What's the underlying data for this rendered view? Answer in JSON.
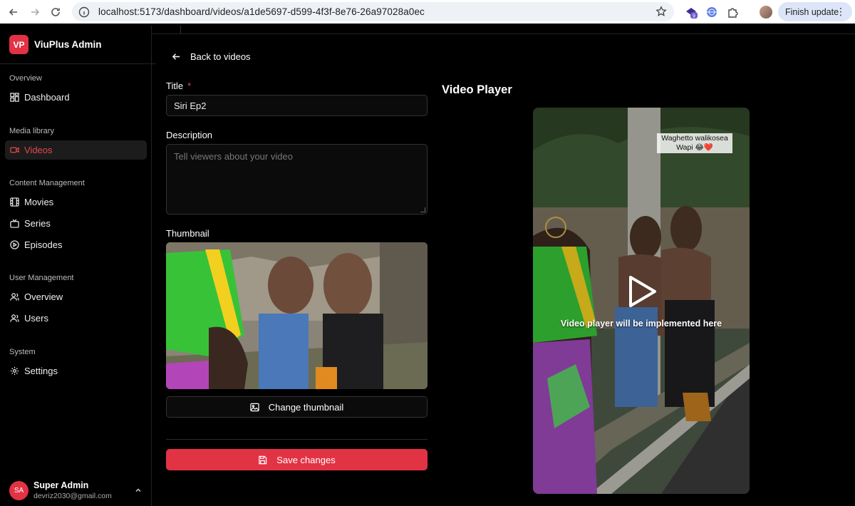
{
  "browser": {
    "url": "localhost:5173/dashboard/videos/a1de5697-d599-4f3f-8e76-26a97028a0ec",
    "extension_badge": "9",
    "finish_update_label": "Finish update"
  },
  "sidebar": {
    "brand": {
      "logo": "VP",
      "name": "ViuPlus Admin"
    },
    "sections": [
      {
        "label": "Overview",
        "items": [
          {
            "label": "Dashboard",
            "icon": "dashboard-icon"
          }
        ]
      },
      {
        "label": "Media library",
        "items": [
          {
            "label": "Videos",
            "icon": "video-icon",
            "active": true
          }
        ]
      },
      {
        "label": "Content Management",
        "items": [
          {
            "label": "Movies",
            "icon": "film-icon"
          },
          {
            "label": "Series",
            "icon": "tv-icon"
          },
          {
            "label": "Episodes",
            "icon": "play-circle-icon"
          }
        ]
      },
      {
        "label": "User Management",
        "items": [
          {
            "label": "Overview",
            "icon": "user-icon"
          },
          {
            "label": "Users",
            "icon": "users-icon"
          }
        ]
      },
      {
        "label": "System",
        "items": [
          {
            "label": "Settings",
            "icon": "gear-icon"
          }
        ]
      }
    ],
    "user": {
      "initials": "SA",
      "name": "Super Admin",
      "email": "devriz2030@gmail.com"
    }
  },
  "main": {
    "back_label": "Back to videos",
    "title_label": "Title",
    "required_mark": "*",
    "title_value": "Siri Ep2",
    "description_label": "Description",
    "description_placeholder": "Tell viewers about your video",
    "thumbnail_label": "Thumbnail",
    "change_thumbnail_label": "Change thumbnail",
    "save_label": "Save changes"
  },
  "player": {
    "title": "Video Player",
    "message": "Video player will be implemented here",
    "caption_line1": "Waghetto walikosea",
    "caption_line2": "Wapi 😂❤️"
  },
  "colors": {
    "accent": "#e23344",
    "active_text": "#e5484d",
    "background": "#000000"
  }
}
